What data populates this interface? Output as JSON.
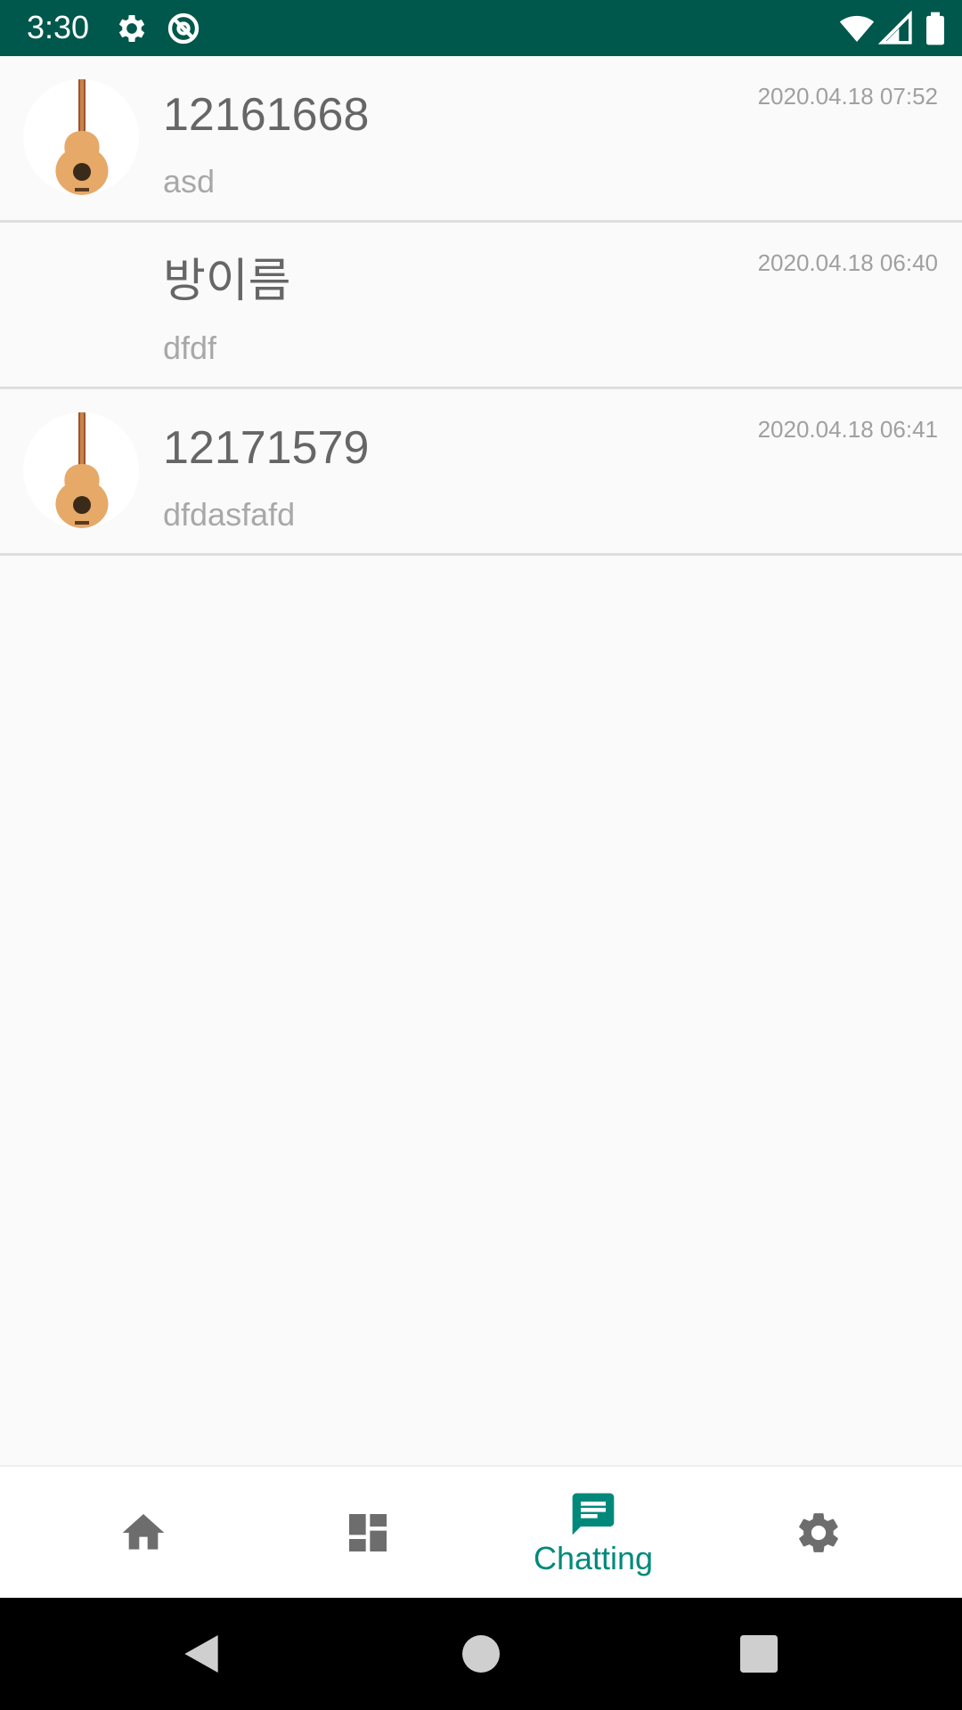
{
  "status_bar": {
    "time": "3:30",
    "icons": [
      "settings-icon",
      "sync-blocked-icon",
      "wifi-icon",
      "signal-icon",
      "battery-icon"
    ],
    "background": "#00574b"
  },
  "chats": [
    {
      "title": "12161668",
      "preview": "asd",
      "time": "2020.04.18 07:52",
      "has_avatar": true,
      "avatar_icon": "guitar-icon"
    },
    {
      "title": "방이름",
      "preview": "dfdf",
      "time": "2020.04.18 06:40",
      "has_avatar": false
    },
    {
      "title": "12171579",
      "preview": "dfdasfafd",
      "time": "2020.04.18 06:41",
      "has_avatar": true,
      "avatar_icon": "guitar-icon"
    }
  ],
  "bottom_nav": {
    "items": [
      {
        "icon": "home-icon",
        "label": "",
        "active": false
      },
      {
        "icon": "dashboard-icon",
        "label": "",
        "active": false
      },
      {
        "icon": "chat-icon",
        "label": "Chatting",
        "active": true
      },
      {
        "icon": "settings-icon",
        "label": "",
        "active": false
      }
    ],
    "active_color": "#00897b",
    "inactive_color": "#6d6d6d"
  },
  "system_nav": {
    "buttons": [
      "back-icon",
      "home-circle-icon",
      "recents-icon"
    ]
  }
}
